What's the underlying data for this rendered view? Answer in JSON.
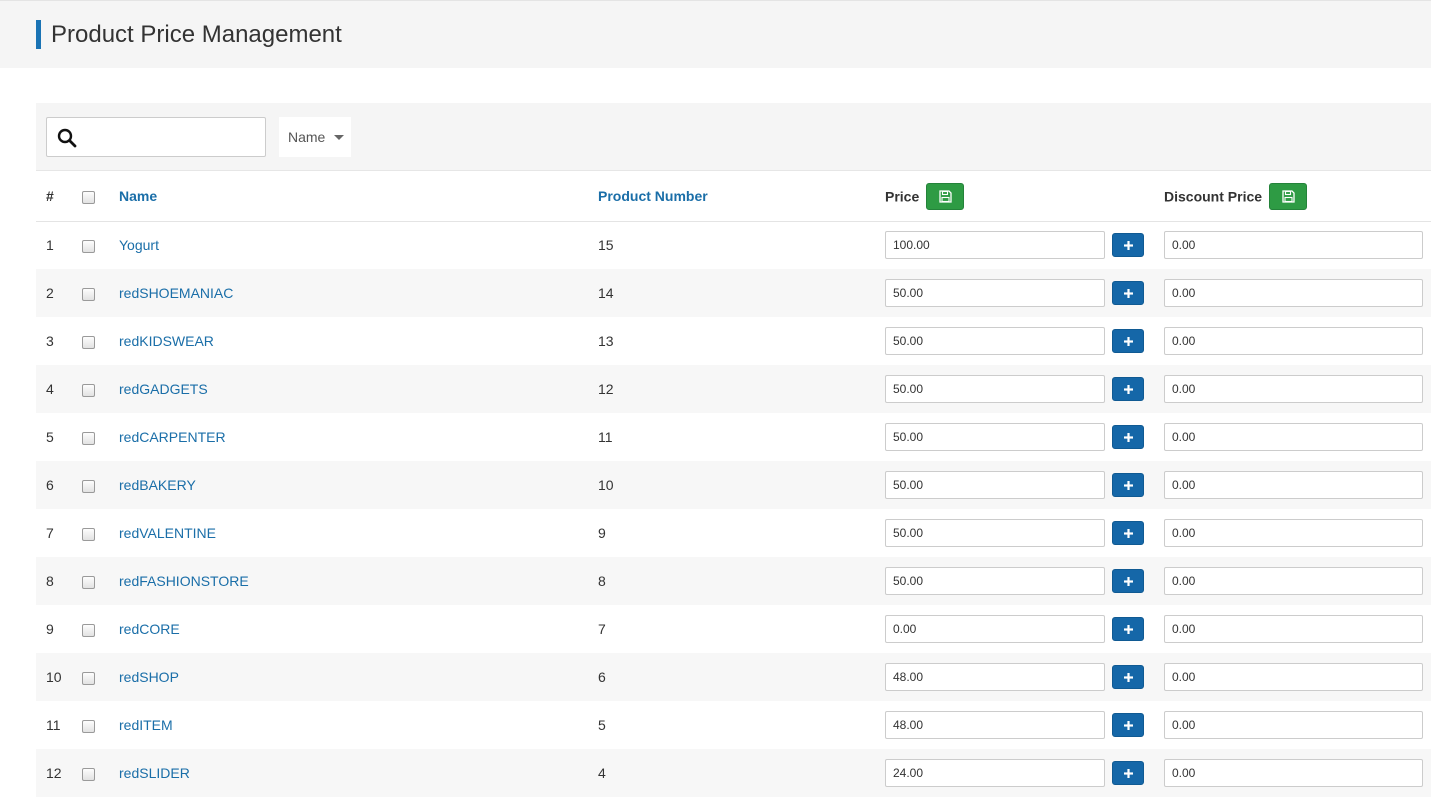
{
  "header": {
    "title": "Product Price Management"
  },
  "toolbar": {
    "search_value": "",
    "sort_selected": "Name"
  },
  "columns": {
    "index": "#",
    "name": "Name",
    "product_number": "Product Number",
    "price": "Price",
    "discount_price": "Discount Price"
  },
  "rows": [
    {
      "index": "1",
      "name": "Yogurt",
      "product_number": "15",
      "price": "100.00",
      "discount_price": "0.00"
    },
    {
      "index": "2",
      "name": "redSHOEMANIAC",
      "product_number": "14",
      "price": "50.00",
      "discount_price": "0.00"
    },
    {
      "index": "3",
      "name": "redKIDSWEAR",
      "product_number": "13",
      "price": "50.00",
      "discount_price": "0.00"
    },
    {
      "index": "4",
      "name": "redGADGETS",
      "product_number": "12",
      "price": "50.00",
      "discount_price": "0.00"
    },
    {
      "index": "5",
      "name": "redCARPENTER",
      "product_number": "11",
      "price": "50.00",
      "discount_price": "0.00"
    },
    {
      "index": "6",
      "name": "redBAKERY",
      "product_number": "10",
      "price": "50.00",
      "discount_price": "0.00"
    },
    {
      "index": "7",
      "name": "redVALENTINE",
      "product_number": "9",
      "price": "50.00",
      "discount_price": "0.00"
    },
    {
      "index": "8",
      "name": "redFASHIONSTORE",
      "product_number": "8",
      "price": "50.00",
      "discount_price": "0.00"
    },
    {
      "index": "9",
      "name": "redCORE",
      "product_number": "7",
      "price": "0.00",
      "discount_price": "0.00"
    },
    {
      "index": "10",
      "name": "redSHOP",
      "product_number": "6",
      "price": "48.00",
      "discount_price": "0.00"
    },
    {
      "index": "11",
      "name": "redITEM",
      "product_number": "5",
      "price": "48.00",
      "discount_price": "0.00"
    },
    {
      "index": "12",
      "name": "redSLIDER",
      "product_number": "4",
      "price": "24.00",
      "discount_price": "0.00"
    }
  ],
  "icons": {
    "search": "search-icon",
    "sort_caret": "caret-down-icon",
    "save": "floppy-disk-icon",
    "add": "plus-icon"
  },
  "colors": {
    "accent": "#1a73b4",
    "link": "#1a6ea8",
    "save_button": "#2e9b44",
    "add_button": "#1567a8"
  }
}
